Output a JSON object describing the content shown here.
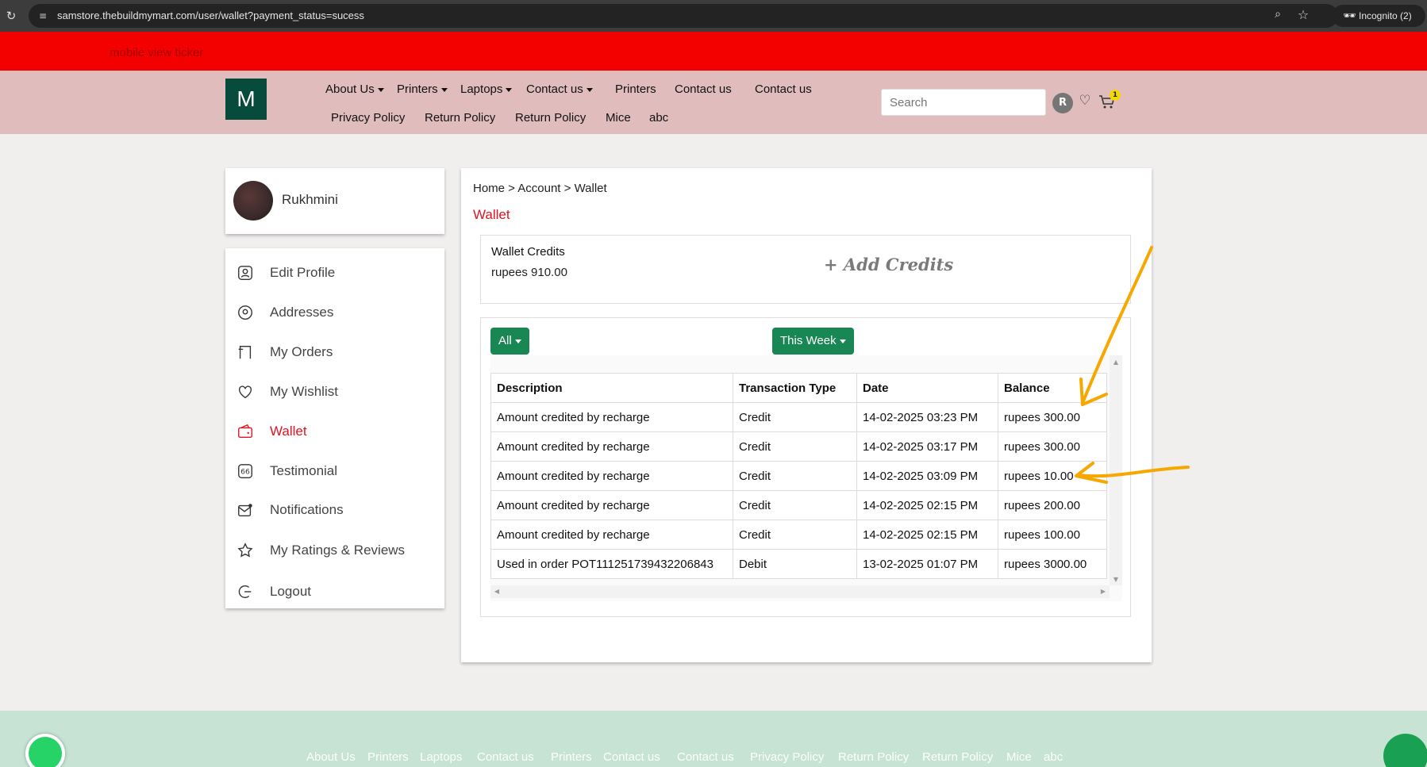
{
  "browser": {
    "url": "samstore.thebuildmymart.com/user/wallet?payment_status=sucess",
    "incognito_label": "Incognito (2)"
  },
  "ticker": {
    "text": "mobile view ticker"
  },
  "header": {
    "logo": "M",
    "nav_row1": [
      "About Us",
      "Printers",
      "Laptops",
      "Contact us",
      "Printers",
      "Contact us",
      "Contact us"
    ],
    "nav_row2": [
      "Privacy Policy",
      "Return Policy",
      "Return Policy",
      "Mice",
      "abc"
    ],
    "search_placeholder": "Search",
    "avatar_initial": "R",
    "cart_count": "1"
  },
  "sidebar": {
    "user_name": "Rukhmini",
    "items": [
      {
        "label": "Edit Profile",
        "icon": "user-icon"
      },
      {
        "label": "Addresses",
        "icon": "location-icon"
      },
      {
        "label": "My Orders",
        "icon": "orders-icon"
      },
      {
        "label": "My Wishlist",
        "icon": "heart-icon"
      },
      {
        "label": "Wallet",
        "icon": "wallet-icon",
        "active": true
      },
      {
        "label": "Testimonial",
        "icon": "quote-icon"
      },
      {
        "label": "Notifications",
        "icon": "mail-icon"
      },
      {
        "label": "My Ratings & Reviews",
        "icon": "star-icon"
      },
      {
        "label": "Logout",
        "icon": "logout-icon"
      }
    ]
  },
  "main": {
    "breadcrumb": "Home > Account > Wallet",
    "title": "Wallet",
    "credits_label": "Wallet Credits",
    "credits_value": "rupees 910.00",
    "add_credits": "+ Add Credits",
    "filter_type": "All",
    "filter_period": "This Week",
    "table": {
      "headers": [
        "Description",
        "Transaction Type",
        "Date",
        "Balance"
      ],
      "rows": [
        [
          "Amount credited by recharge",
          "Credit",
          "14-02-2025 03:23 PM",
          "rupees 300.00"
        ],
        [
          "Amount credited by recharge",
          "Credit",
          "14-02-2025 03:17 PM",
          "rupees 300.00"
        ],
        [
          "Amount credited by recharge",
          "Credit",
          "14-02-2025 03:09 PM",
          "rupees 10.00"
        ],
        [
          "Amount credited by recharge",
          "Credit",
          "14-02-2025 02:15 PM",
          "rupees 200.00"
        ],
        [
          "Amount credited by recharge",
          "Credit",
          "14-02-2025 02:15 PM",
          "rupees 100.00"
        ],
        [
          "Used in order POT111251739432206843",
          "Debit",
          "13-02-2025 01:07 PM",
          "rupees 3000.00"
        ]
      ]
    }
  },
  "footer": {
    "links": [
      "About Us",
      "Printers",
      "Laptops",
      "Contact us",
      "Printers",
      "Contact us",
      "Contact us",
      "Privacy Policy",
      "Return Policy",
      "Return Policy",
      "Mice",
      "abc"
    ]
  },
  "colors": {
    "ticker": "#f30000",
    "header": "#e0bcbc",
    "accent_red": "#e0131e",
    "button_green": "#198754",
    "footer": "#c6e3d3",
    "annotation_orange": "#f6a700"
  }
}
